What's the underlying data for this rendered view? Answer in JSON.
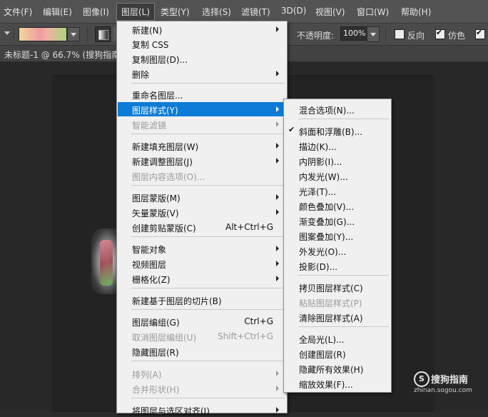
{
  "menubar": {
    "items": [
      "文件(F)",
      "编辑(E)",
      "图像(I)",
      "图层(L)",
      "类型(Y)",
      "选择(S)",
      "滤镜(T)",
      "3D(D)",
      "视图(V)",
      "窗口(W)",
      "帮助(H)"
    ],
    "active": "图层(L)"
  },
  "options": {
    "opacity_label": "不透明度:",
    "opacity_value": "100%",
    "reverse_label": "反向",
    "dither_label": "仿色",
    "reverse_checked": false,
    "dither_checked": true
  },
  "document": {
    "tab_title": "未标题-1 @ 66.7% (搜狗指南"
  },
  "layer_menu": {
    "items": [
      {
        "label": "新建(N)",
        "shortcut": "",
        "submenu": true,
        "disabled": false
      },
      {
        "label": "复制 CSS",
        "shortcut": "",
        "submenu": false,
        "disabled": false
      },
      {
        "label": "复制图层(D)...",
        "shortcut": "",
        "submenu": false,
        "disabled": false
      },
      {
        "label": "删除",
        "shortcut": "",
        "submenu": true,
        "disabled": false
      },
      {
        "label": "重命名图层...",
        "shortcut": "",
        "submenu": false,
        "disabled": false
      },
      {
        "label": "图层样式(Y)",
        "shortcut": "",
        "submenu": true,
        "disabled": false,
        "highlighted": true
      },
      {
        "label": "智能滤镜",
        "shortcut": "",
        "submenu": true,
        "disabled": true
      },
      {
        "label": "新建填充图层(W)",
        "shortcut": "",
        "submenu": true,
        "disabled": false
      },
      {
        "label": "新建调整图层(J)",
        "shortcut": "",
        "submenu": true,
        "disabled": false
      },
      {
        "label": "图层内容选项(O)...",
        "shortcut": "",
        "submenu": false,
        "disabled": true
      },
      {
        "label": "图层蒙版(M)",
        "shortcut": "",
        "submenu": true,
        "disabled": false
      },
      {
        "label": "矢量蒙版(V)",
        "shortcut": "",
        "submenu": true,
        "disabled": false
      },
      {
        "label": "创建剪贴蒙版(C)",
        "shortcut": "Alt+Ctrl+G",
        "submenu": false,
        "disabled": false
      },
      {
        "label": "智能对象",
        "shortcut": "",
        "submenu": true,
        "disabled": false
      },
      {
        "label": "视频图层",
        "shortcut": "",
        "submenu": true,
        "disabled": false
      },
      {
        "label": "栅格化(Z)",
        "shortcut": "",
        "submenu": true,
        "disabled": false
      },
      {
        "label": "新建基于图层的切片(B)",
        "shortcut": "",
        "submenu": false,
        "disabled": false
      },
      {
        "label": "图层编组(G)",
        "shortcut": "Ctrl+G",
        "submenu": false,
        "disabled": false
      },
      {
        "label": "取消图层编组(U)",
        "shortcut": "Shift+Ctrl+G",
        "submenu": false,
        "disabled": true
      },
      {
        "label": "隐藏图层(R)",
        "shortcut": "",
        "submenu": false,
        "disabled": false
      },
      {
        "label": "排列(A)",
        "shortcut": "",
        "submenu": true,
        "disabled": true
      },
      {
        "label": "合并形状(H)",
        "shortcut": "",
        "submenu": true,
        "disabled": true
      },
      {
        "label": "将图层与选区对齐(I)",
        "shortcut": "",
        "submenu": true,
        "disabled": false
      }
    ]
  },
  "style_menu": {
    "items": [
      {
        "label": "混合选项(N)...",
        "checked": false,
        "disabled": false
      },
      {
        "label": "斜面和浮雕(B)...",
        "checked": true,
        "disabled": false
      },
      {
        "label": "描边(K)...",
        "checked": false,
        "disabled": false
      },
      {
        "label": "内阴影(I)...",
        "checked": false,
        "disabled": false
      },
      {
        "label": "内发光(W)...",
        "checked": false,
        "disabled": false
      },
      {
        "label": "光泽(T)...",
        "checked": false,
        "disabled": false
      },
      {
        "label": "颜色叠加(V)...",
        "checked": false,
        "disabled": false
      },
      {
        "label": "渐变叠加(G)...",
        "checked": false,
        "disabled": false
      },
      {
        "label": "图案叠加(Y)...",
        "checked": false,
        "disabled": false
      },
      {
        "label": "外发光(O)...",
        "checked": false,
        "disabled": false
      },
      {
        "label": "投影(D)...",
        "checked": false,
        "disabled": false
      },
      {
        "label": "拷贝图层样式(C)",
        "checked": false,
        "disabled": false
      },
      {
        "label": "粘贴图层样式(P)",
        "checked": false,
        "disabled": true
      },
      {
        "label": "清除图层样式(A)",
        "checked": false,
        "disabled": false
      },
      {
        "label": "全局光(L)...",
        "checked": false,
        "disabled": false
      },
      {
        "label": "创建图层(R)",
        "checked": false,
        "disabled": false
      },
      {
        "label": "隐藏所有效果(H)",
        "checked": false,
        "disabled": false
      },
      {
        "label": "缩放效果(F)...",
        "checked": false,
        "disabled": false
      }
    ]
  },
  "watermark": {
    "logo": "S",
    "name": "搜狗指南",
    "url": "zhinan.sogou.com"
  },
  "colors": {
    "highlight": "#0c7bd6",
    "menu_bg": "#f0f0f0",
    "app_bg": "#535353"
  }
}
